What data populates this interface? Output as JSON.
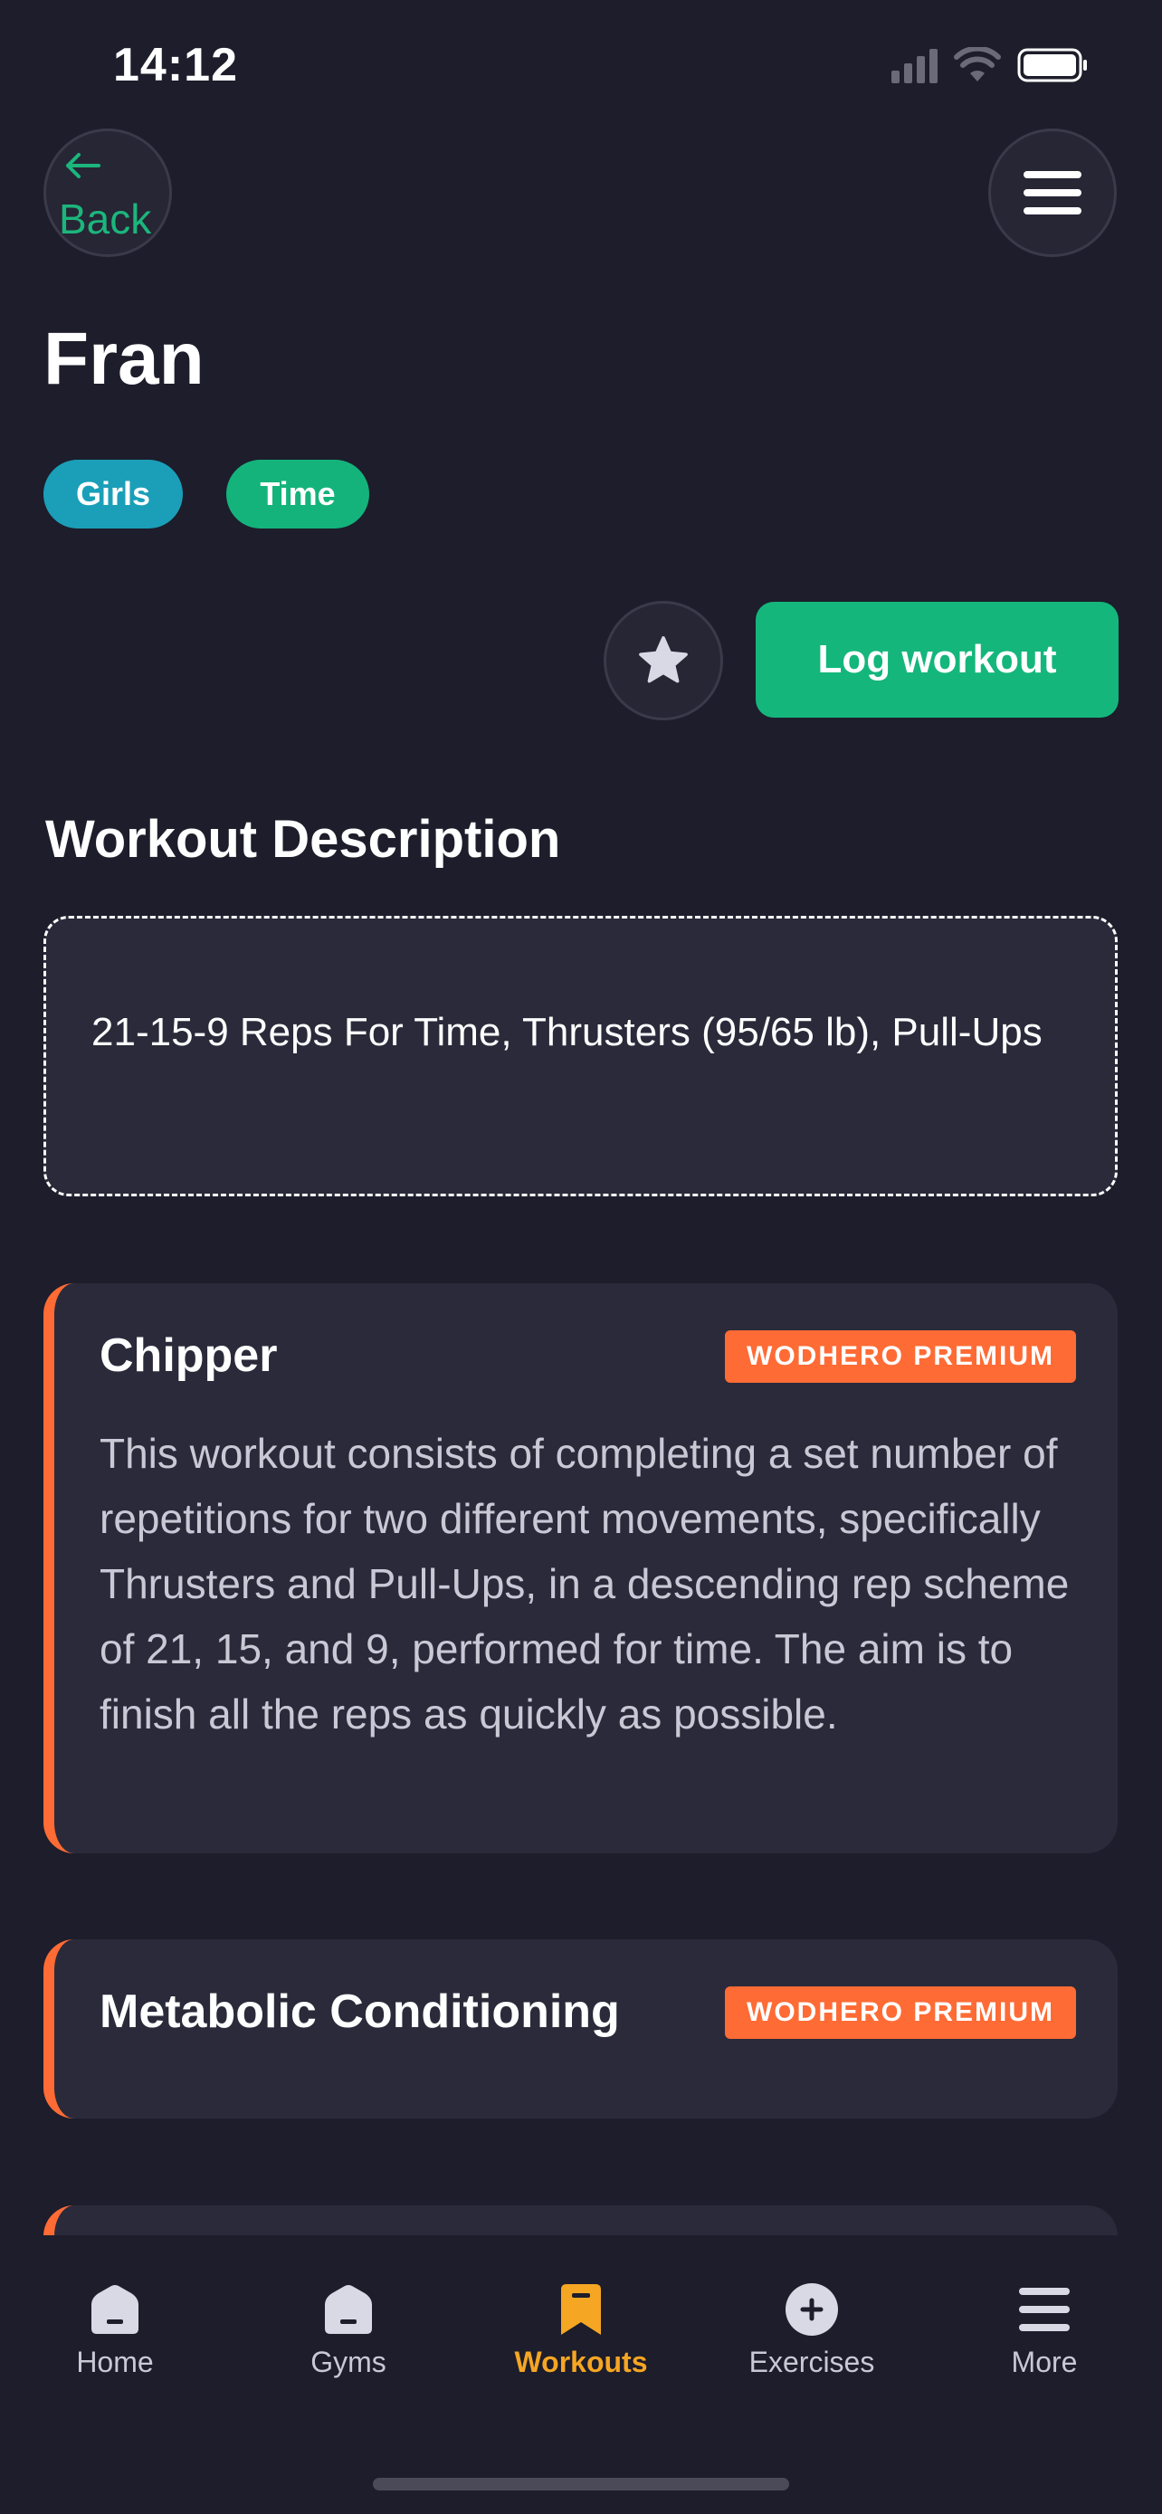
{
  "status_bar": {
    "time": "14:12"
  },
  "nav": {
    "back_label": "Back"
  },
  "workout": {
    "title": "Fran",
    "tags": [
      "Girls",
      "Time"
    ],
    "log_button_label": "Log workout"
  },
  "description": {
    "section_title": "Workout Description",
    "text": "21-15-9 Reps For Time, Thrusters (95/65 lb), Pull-Ups"
  },
  "cards": [
    {
      "title": "Chipper",
      "badge": "WODHERO PREMIUM",
      "body": "This workout consists of completing a set number of repetitions for two different movements, specifically Thrusters and Pull-Ups, in a descending rep scheme of 21, 15, and 9, performed for time. The aim is to finish all the reps as quickly as possible."
    },
    {
      "title": "Metabolic Conditioning",
      "badge": "WODHERO PREMIUM"
    }
  ],
  "tab_bar": {
    "items": [
      {
        "label": "Home",
        "icon": "home-icon"
      },
      {
        "label": "Gyms",
        "icon": "gym-icon"
      },
      {
        "label": "Workouts",
        "icon": "bookmark-icon",
        "active": true
      },
      {
        "label": "Exercises",
        "icon": "plus-circle-icon"
      },
      {
        "label": "More",
        "icon": "hamburger-menu-icon"
      }
    ]
  },
  "colors": {
    "background": "#1d1d2b",
    "accent_green": "#14b67c",
    "accent_orange": "#ff6b35",
    "tag_blue": "#1b9fb8",
    "active_tab": "#f5a623"
  }
}
